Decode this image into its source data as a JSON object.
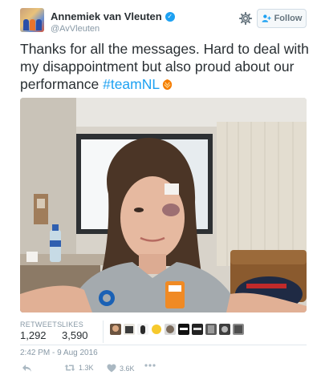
{
  "user": {
    "display_name": "Annemiek van Vleuten",
    "handle": "@AvVleuten",
    "verified_icon": "verified-badge-icon"
  },
  "header": {
    "settings_icon": "gear-icon",
    "follow_label": "Follow"
  },
  "tweet": {
    "text_before": "Thanks for all the messages. Hard to deal with my disappointment but also proud about our performance ",
    "hashtag": "#teamNL",
    "emoji_icon": "orange-lion-emoji"
  },
  "stats": {
    "retweets_label": "RETWEETS",
    "retweets_value": "1,292",
    "likes_label": "LIKES",
    "likes_value": "3,590"
  },
  "timestamp": "2:42 PM - 9 Aug 2016",
  "actions": {
    "reply_icon": "reply-icon",
    "retweet_count": "1.3K",
    "like_count": "3.6K",
    "more_icon": "more-dots-icon"
  },
  "colors": {
    "link": "#1da1f2",
    "muted": "#8899a6",
    "text": "#292f33"
  }
}
